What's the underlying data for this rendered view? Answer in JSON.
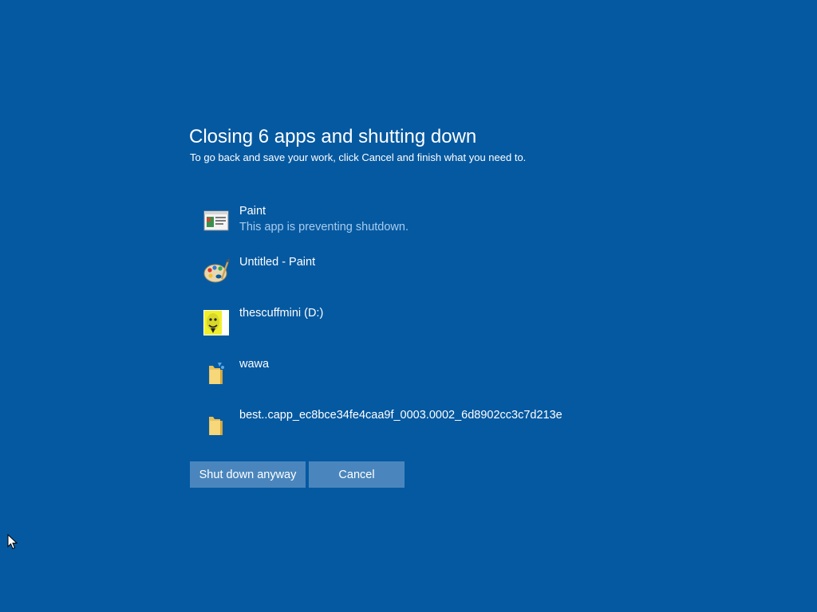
{
  "dialog": {
    "title": "Closing 6 apps and shutting down",
    "subtitle": "To go back and save your work, click Cancel and finish what you need to."
  },
  "apps": [
    {
      "name": "Paint",
      "status": "This app is preventing shutdown.",
      "icon": "paint-app-icon"
    },
    {
      "name": "Untitled - Paint",
      "icon": "paint-palette-icon"
    },
    {
      "name": "thescuffmini (D:)",
      "icon": "drive-icon"
    },
    {
      "name": "wawa",
      "icon": "folder-icon"
    },
    {
      "name": "best..capp_ec8bce34fe4caa9f_0003.0002_6d8902cc3c7d213e",
      "icon": "folder-icon"
    }
  ],
  "buttons": {
    "shutdown_label": "Shut down anyway",
    "cancel_label": "Cancel"
  },
  "colors": {
    "background": "#0559a1",
    "button": "#4a86bd",
    "status_text": "#a8cdee"
  }
}
